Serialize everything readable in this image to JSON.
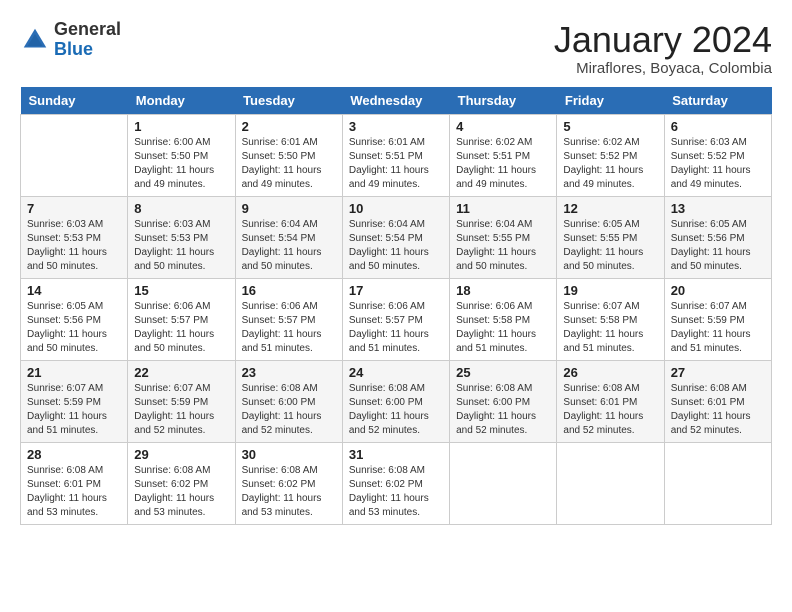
{
  "logo": {
    "general": "General",
    "blue": "Blue"
  },
  "title": "January 2024",
  "location": "Miraflores, Boyaca, Colombia",
  "days_of_week": [
    "Sunday",
    "Monday",
    "Tuesday",
    "Wednesday",
    "Thursday",
    "Friday",
    "Saturday"
  ],
  "weeks": [
    [
      {
        "day": "",
        "sunrise": "",
        "sunset": "",
        "daylight": ""
      },
      {
        "day": "1",
        "sunrise": "Sunrise: 6:00 AM",
        "sunset": "Sunset: 5:50 PM",
        "daylight": "Daylight: 11 hours and 49 minutes."
      },
      {
        "day": "2",
        "sunrise": "Sunrise: 6:01 AM",
        "sunset": "Sunset: 5:50 PM",
        "daylight": "Daylight: 11 hours and 49 minutes."
      },
      {
        "day": "3",
        "sunrise": "Sunrise: 6:01 AM",
        "sunset": "Sunset: 5:51 PM",
        "daylight": "Daylight: 11 hours and 49 minutes."
      },
      {
        "day": "4",
        "sunrise": "Sunrise: 6:02 AM",
        "sunset": "Sunset: 5:51 PM",
        "daylight": "Daylight: 11 hours and 49 minutes."
      },
      {
        "day": "5",
        "sunrise": "Sunrise: 6:02 AM",
        "sunset": "Sunset: 5:52 PM",
        "daylight": "Daylight: 11 hours and 49 minutes."
      },
      {
        "day": "6",
        "sunrise": "Sunrise: 6:03 AM",
        "sunset": "Sunset: 5:52 PM",
        "daylight": "Daylight: 11 hours and 49 minutes."
      }
    ],
    [
      {
        "day": "7",
        "sunrise": "Sunrise: 6:03 AM",
        "sunset": "Sunset: 5:53 PM",
        "daylight": "Daylight: 11 hours and 50 minutes."
      },
      {
        "day": "8",
        "sunrise": "Sunrise: 6:03 AM",
        "sunset": "Sunset: 5:53 PM",
        "daylight": "Daylight: 11 hours and 50 minutes."
      },
      {
        "day": "9",
        "sunrise": "Sunrise: 6:04 AM",
        "sunset": "Sunset: 5:54 PM",
        "daylight": "Daylight: 11 hours and 50 minutes."
      },
      {
        "day": "10",
        "sunrise": "Sunrise: 6:04 AM",
        "sunset": "Sunset: 5:54 PM",
        "daylight": "Daylight: 11 hours and 50 minutes."
      },
      {
        "day": "11",
        "sunrise": "Sunrise: 6:04 AM",
        "sunset": "Sunset: 5:55 PM",
        "daylight": "Daylight: 11 hours and 50 minutes."
      },
      {
        "day": "12",
        "sunrise": "Sunrise: 6:05 AM",
        "sunset": "Sunset: 5:55 PM",
        "daylight": "Daylight: 11 hours and 50 minutes."
      },
      {
        "day": "13",
        "sunrise": "Sunrise: 6:05 AM",
        "sunset": "Sunset: 5:56 PM",
        "daylight": "Daylight: 11 hours and 50 minutes."
      }
    ],
    [
      {
        "day": "14",
        "sunrise": "Sunrise: 6:05 AM",
        "sunset": "Sunset: 5:56 PM",
        "daylight": "Daylight: 11 hours and 50 minutes."
      },
      {
        "day": "15",
        "sunrise": "Sunrise: 6:06 AM",
        "sunset": "Sunset: 5:57 PM",
        "daylight": "Daylight: 11 hours and 50 minutes."
      },
      {
        "day": "16",
        "sunrise": "Sunrise: 6:06 AM",
        "sunset": "Sunset: 5:57 PM",
        "daylight": "Daylight: 11 hours and 51 minutes."
      },
      {
        "day": "17",
        "sunrise": "Sunrise: 6:06 AM",
        "sunset": "Sunset: 5:57 PM",
        "daylight": "Daylight: 11 hours and 51 minutes."
      },
      {
        "day": "18",
        "sunrise": "Sunrise: 6:06 AM",
        "sunset": "Sunset: 5:58 PM",
        "daylight": "Daylight: 11 hours and 51 minutes."
      },
      {
        "day": "19",
        "sunrise": "Sunrise: 6:07 AM",
        "sunset": "Sunset: 5:58 PM",
        "daylight": "Daylight: 11 hours and 51 minutes."
      },
      {
        "day": "20",
        "sunrise": "Sunrise: 6:07 AM",
        "sunset": "Sunset: 5:59 PM",
        "daylight": "Daylight: 11 hours and 51 minutes."
      }
    ],
    [
      {
        "day": "21",
        "sunrise": "Sunrise: 6:07 AM",
        "sunset": "Sunset: 5:59 PM",
        "daylight": "Daylight: 11 hours and 51 minutes."
      },
      {
        "day": "22",
        "sunrise": "Sunrise: 6:07 AM",
        "sunset": "Sunset: 5:59 PM",
        "daylight": "Daylight: 11 hours and 52 minutes."
      },
      {
        "day": "23",
        "sunrise": "Sunrise: 6:08 AM",
        "sunset": "Sunset: 6:00 PM",
        "daylight": "Daylight: 11 hours and 52 minutes."
      },
      {
        "day": "24",
        "sunrise": "Sunrise: 6:08 AM",
        "sunset": "Sunset: 6:00 PM",
        "daylight": "Daylight: 11 hours and 52 minutes."
      },
      {
        "day": "25",
        "sunrise": "Sunrise: 6:08 AM",
        "sunset": "Sunset: 6:00 PM",
        "daylight": "Daylight: 11 hours and 52 minutes."
      },
      {
        "day": "26",
        "sunrise": "Sunrise: 6:08 AM",
        "sunset": "Sunset: 6:01 PM",
        "daylight": "Daylight: 11 hours and 52 minutes."
      },
      {
        "day": "27",
        "sunrise": "Sunrise: 6:08 AM",
        "sunset": "Sunset: 6:01 PM",
        "daylight": "Daylight: 11 hours and 52 minutes."
      }
    ],
    [
      {
        "day": "28",
        "sunrise": "Sunrise: 6:08 AM",
        "sunset": "Sunset: 6:01 PM",
        "daylight": "Daylight: 11 hours and 53 minutes."
      },
      {
        "day": "29",
        "sunrise": "Sunrise: 6:08 AM",
        "sunset": "Sunset: 6:02 PM",
        "daylight": "Daylight: 11 hours and 53 minutes."
      },
      {
        "day": "30",
        "sunrise": "Sunrise: 6:08 AM",
        "sunset": "Sunset: 6:02 PM",
        "daylight": "Daylight: 11 hours and 53 minutes."
      },
      {
        "day": "31",
        "sunrise": "Sunrise: 6:08 AM",
        "sunset": "Sunset: 6:02 PM",
        "daylight": "Daylight: 11 hours and 53 minutes."
      },
      {
        "day": "",
        "sunrise": "",
        "sunset": "",
        "daylight": ""
      },
      {
        "day": "",
        "sunrise": "",
        "sunset": "",
        "daylight": ""
      },
      {
        "day": "",
        "sunrise": "",
        "sunset": "",
        "daylight": ""
      }
    ]
  ]
}
